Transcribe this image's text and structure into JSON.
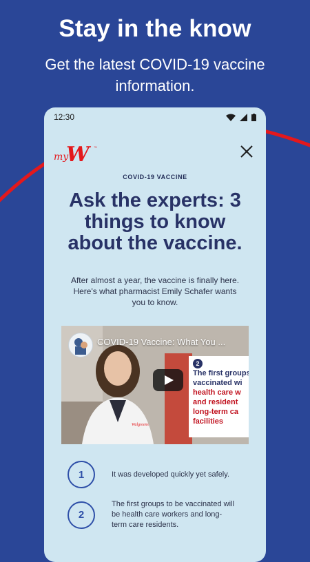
{
  "hero": {
    "title": "Stay in the know",
    "subtitle": "Get the latest COVID-19 vaccine information."
  },
  "status_bar": {
    "time": "12:30",
    "icons": [
      "wifi-icon",
      "signal-icon",
      "battery-icon"
    ]
  },
  "header": {
    "logo_text": "myW",
    "close_icon": "close-icon"
  },
  "article": {
    "eyebrow": "COVID-19 VACCINE",
    "headline": "Ask the experts: 3 things to know about the vaccine.",
    "intro": "After almost a year, the vaccine is finally here. Here's what pharmacist Emily Schafer wants you to know."
  },
  "video": {
    "title": "COVID-19 Vaccine: What You ...",
    "coat_logo": "Walgreens",
    "slide_number": "2",
    "slide_lines_dark": [
      "The first groups",
      "vaccinated wi"
    ],
    "slide_lines_red": [
      "health care w",
      "and resident",
      "long-term ca",
      "facilities"
    ]
  },
  "steps": [
    {
      "number": "1",
      "text": "It was developed quickly yet safely."
    },
    {
      "number": "2",
      "text": "The first groups to be vaccinated will be health care workers and long-term care residents."
    }
  ],
  "colors": {
    "background": "#2a4697",
    "card": "#cfe6f1",
    "headline": "#283266",
    "accent_red": "#e4181c",
    "step_blue": "#2e4fa8"
  }
}
